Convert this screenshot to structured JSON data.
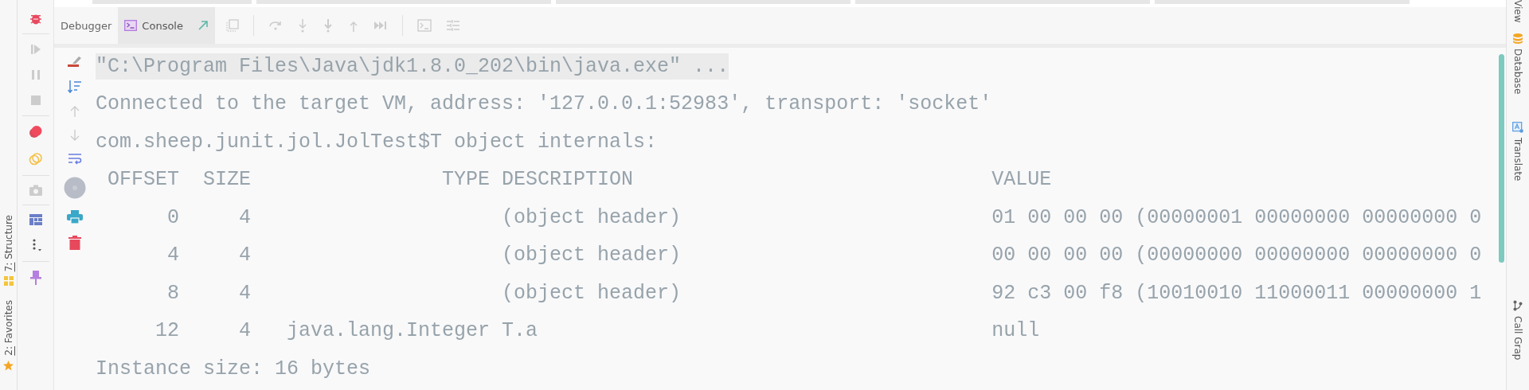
{
  "left_stripe": {
    "tools": [
      {
        "label": "7: Structure",
        "kind": "structure"
      },
      {
        "label": "2: Favorites",
        "kind": "favorites"
      }
    ]
  },
  "debug_toolbar": {
    "tabs": [
      {
        "label": "Debugger",
        "selected": false,
        "kind": "debugger"
      },
      {
        "label": "Console",
        "selected": true,
        "kind": "console"
      }
    ]
  },
  "console": {
    "lines": [
      {
        "text": "\"C:\\Program Files\\Java\\jdk1.8.0_202\\bin\\java.exe\" ...",
        "highlighted": true
      },
      {
        "text": "Connected to the target VM, address: '127.0.0.1:52983', transport: 'socket'",
        "highlighted": false
      },
      {
        "text": "com.sheep.junit.jol.JolTest$T object internals:",
        "highlighted": false
      }
    ],
    "table": {
      "columns": [
        "OFFSET",
        "SIZE",
        "TYPE",
        "DESCRIPTION",
        "VALUE"
      ],
      "rows": [
        [
          "0",
          "4",
          "",
          "(object header)",
          "01 00 00 00 (00000001 00000000 00000000 0"
        ],
        [
          "4",
          "4",
          "",
          "(object header)",
          "00 00 00 00 (00000000 00000000 00000000 0"
        ],
        [
          "8",
          "4",
          "",
          "(object header)",
          "92 c3 00 f8 (10010010 11000011 00000000 1"
        ],
        [
          "12",
          "4",
          "java.lang.Integer",
          "T.a",
          "null"
        ]
      ]
    },
    "summary": "Instance size: 16 bytes"
  },
  "right_stripe": {
    "tools": [
      {
        "label": "View",
        "kind": "view"
      },
      {
        "label": "Database",
        "kind": "database"
      },
      {
        "label": "Translate",
        "kind": "translate"
      },
      {
        "label": "Call Grap",
        "kind": "callgraph"
      }
    ]
  }
}
